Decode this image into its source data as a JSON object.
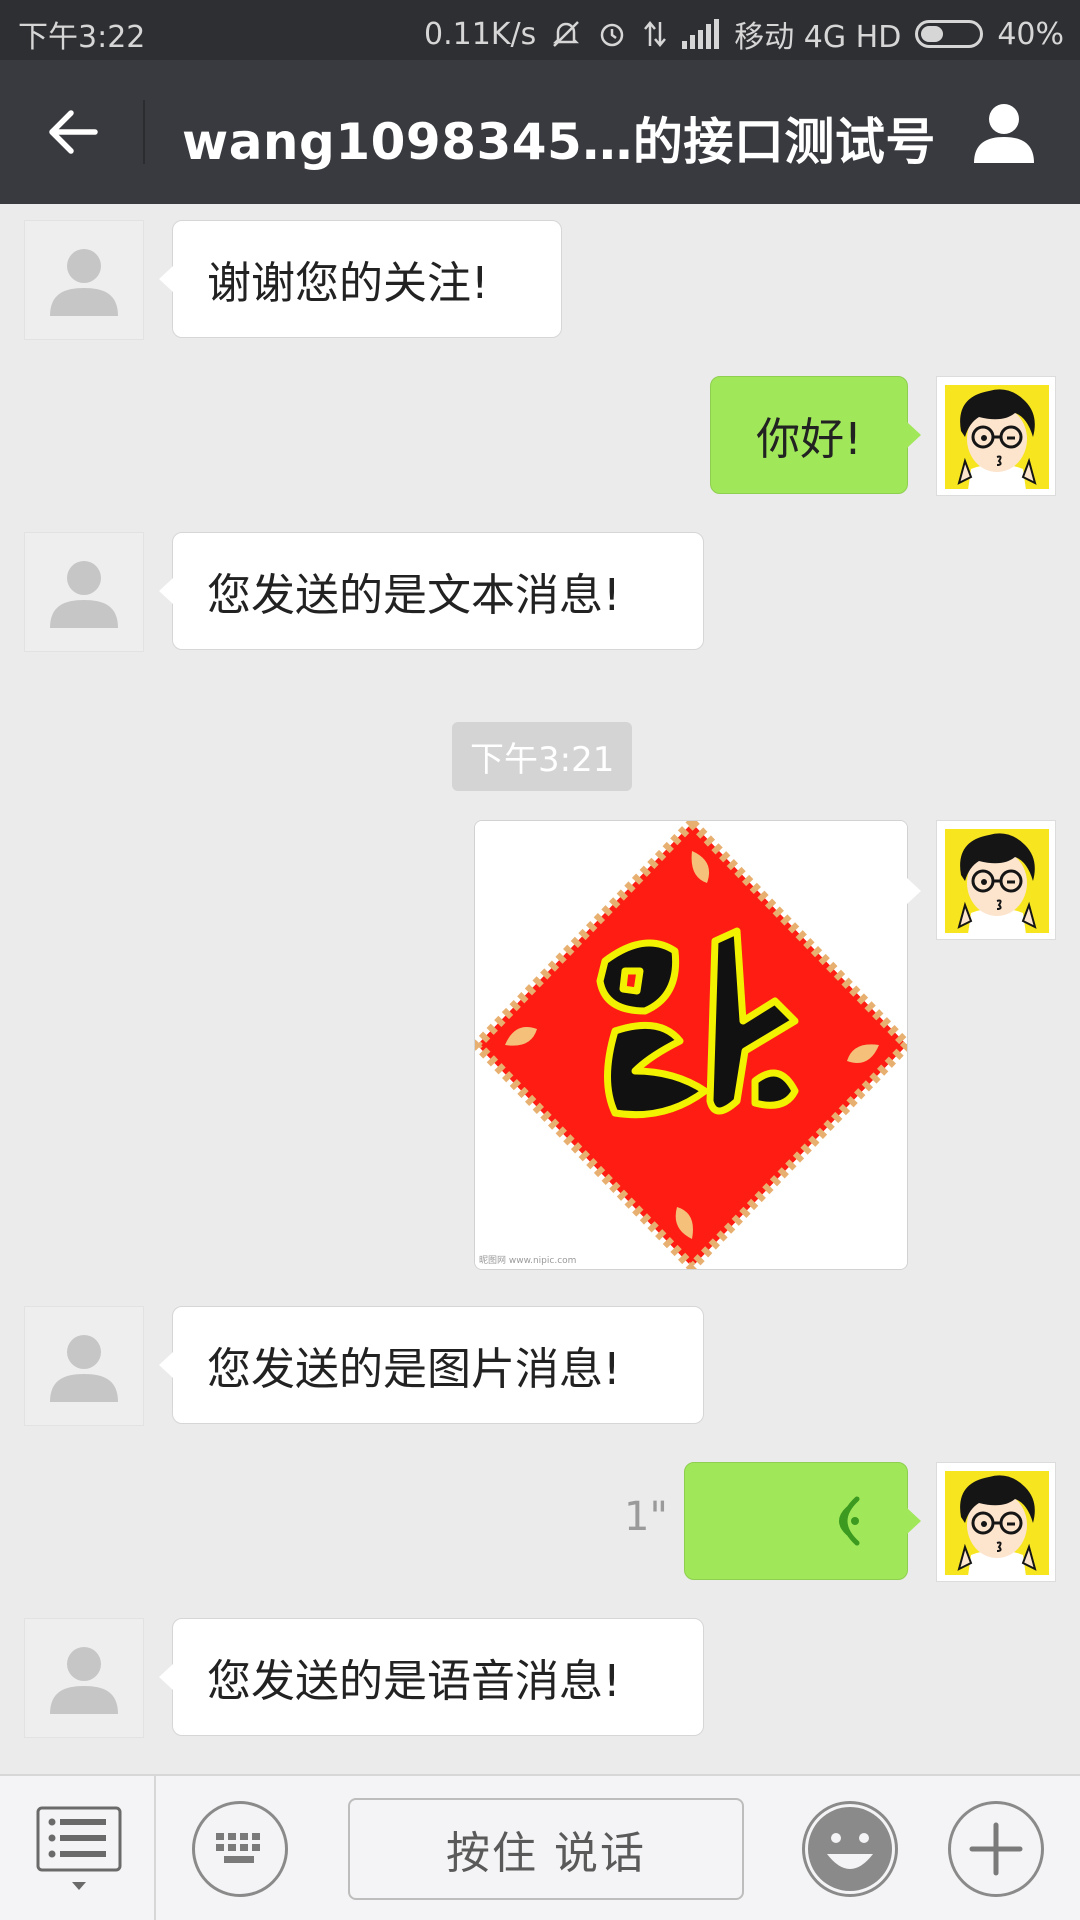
{
  "status_bar": {
    "time": "下午3:22",
    "net_speed": "0.11K/s",
    "carrier": "移动 4G HD",
    "battery": "40%",
    "battery_level": 0.4
  },
  "header": {
    "title": "wang1098345…的接口测试号",
    "back_icon": "arrow-left-icon",
    "profile_icon": "person-icon"
  },
  "messages": [
    {
      "from": "bot",
      "type": "text",
      "text": "谢谢您的关注!"
    },
    {
      "from": "me",
      "type": "text",
      "text": "你好!"
    },
    {
      "from": "bot",
      "type": "text",
      "text": "您发送的是文本消息!"
    },
    {
      "type": "timestamp",
      "text": "下午3:21"
    },
    {
      "from": "me",
      "type": "image",
      "glyph": "福",
      "colors": {
        "card": "#ff1c12",
        "glyph": "#111111",
        "outline": "#f2f200"
      }
    },
    {
      "from": "bot",
      "type": "text",
      "text": "您发送的是图片消息!"
    },
    {
      "from": "me",
      "type": "voice",
      "duration": "1\""
    },
    {
      "from": "bot",
      "type": "text",
      "text": "您发送的是语音消息!"
    }
  ],
  "input_bar": {
    "hold_to_talk_label": "按住 说话",
    "menu_icon": "list-icon",
    "keyboard_icon": "keyboard-icon",
    "emoji_icon": "emoji-icon",
    "add_icon": "plus-icon"
  },
  "colors": {
    "title_bar": "#393a3f",
    "status_bar": "#2e2f33",
    "chat_bg": "#ebebeb",
    "out_bubble": "#a0e75a",
    "in_bubble": "#ffffff"
  }
}
